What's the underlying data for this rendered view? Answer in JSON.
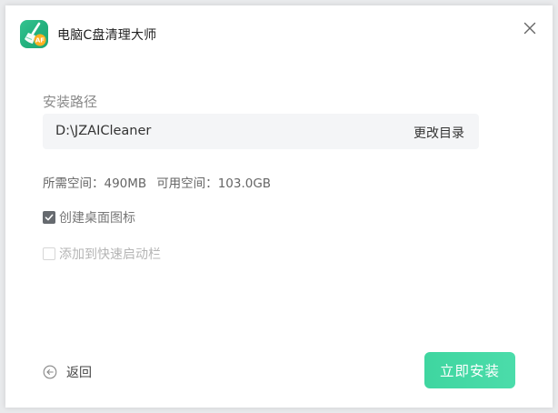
{
  "window": {
    "title": "电脑C盘清理大师",
    "icon": "broom-icon",
    "icon_badge": "AF",
    "close_icon": "close-icon"
  },
  "install": {
    "path_label": "安装路径",
    "path_value": "D:\\JZAICleaner",
    "change_dir_label": "更改目录"
  },
  "space": {
    "required_label": "所需空间：",
    "required_value": "490MB",
    "available_label": "可用空间：",
    "available_value": "103.0GB"
  },
  "options": [
    {
      "label": "创建桌面图标",
      "checked": true
    },
    {
      "label": "添加到快速启动栏",
      "checked": false
    }
  ],
  "footer": {
    "back_label": "返回",
    "install_label": "立即安装"
  },
  "colors": {
    "accent": "#44d8a4",
    "checkbox_checked": "#666a6f",
    "icon_green": "#2bb985"
  }
}
